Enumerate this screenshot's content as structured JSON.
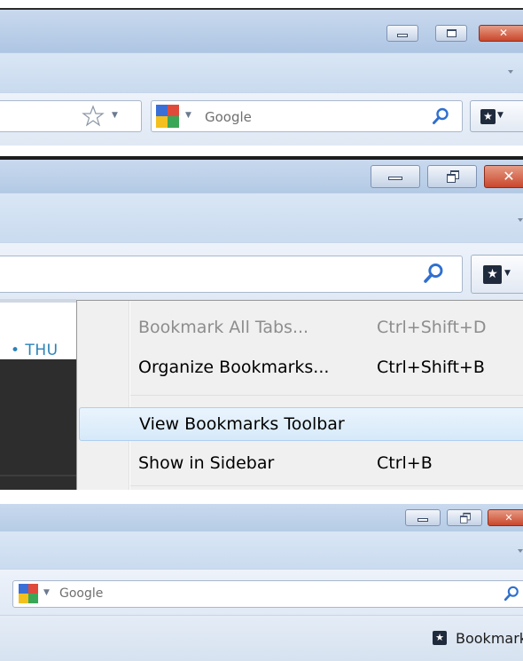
{
  "window_controls": {
    "minimize_icon": "minimize-icon",
    "maximize_icon": "maximize-icon",
    "restore_icon": "restore-icon",
    "close_icon": "close-icon",
    "close_glyph": "✕"
  },
  "search_bar": {
    "engine_placeholder": "Google",
    "engine_icon": "google-icon",
    "search_icon": "magnifier-icon"
  },
  "bookmark_star_icon": "star-icon",
  "bookmarks_menu_button_icon": "bookmarks-menu-icon",
  "page_snippet": {
    "text": "• THU"
  },
  "bookmarks_menu": {
    "items": [
      {
        "label": "Bookmark All Tabs...",
        "shortcut": "Ctrl+Shift+D",
        "enabled": false
      },
      {
        "label": "Organize Bookmarks...",
        "shortcut": "Ctrl+Shift+B",
        "enabled": true
      },
      {
        "label": "View Bookmarks Toolbar",
        "shortcut": "",
        "enabled": true,
        "highlighted": true
      },
      {
        "label": "Show in Sidebar",
        "shortcut": "Ctrl+B",
        "enabled": true
      }
    ]
  },
  "bookmarks_toolbar": {
    "label": "Bookmark"
  },
  "colors": {
    "titlebar": "#b3cae5",
    "close_button": "#c9472c",
    "menu_highlight": "#d6e9f9",
    "link_blue": "#2b82b8"
  }
}
